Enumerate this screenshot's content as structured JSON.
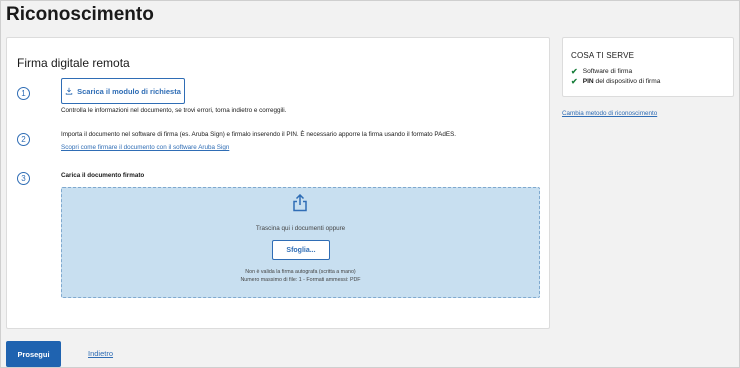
{
  "page": {
    "title": "Riconoscimento"
  },
  "main": {
    "section_title": "Firma digitale remota",
    "steps": [
      {
        "number": "1",
        "button_label": "Scarica il modulo di richiesta",
        "text": "Controlla le informazioni nel documento, se trovi errori, torna indietro e correggili."
      },
      {
        "number": "2",
        "text": "Importa il documento nel software di firma (es. Aruba Sign) e firmalo inserendo il PIN. È necessario apporre la firma usando il formato PAdES.",
        "link": "Scopri come firmare il documento con il software Aruba Sign"
      },
      {
        "number": "3",
        "label": "Carica il documento firmato"
      }
    ],
    "dropzone": {
      "instruction": "Trascina qui i documenti oppure",
      "browse_label": "Sfoglia...",
      "note_1": "Non è valida la firma autografa (scritta a mano)",
      "note_2": "Numero massimo di file: 1 - Formati ammessi: PDF"
    }
  },
  "sidebar": {
    "title": "COSA TI SERVE",
    "items": [
      {
        "bold": "",
        "text": "Software di firma"
      },
      {
        "bold": "PIN",
        "text": " del dispositivo di firma"
      }
    ],
    "link": "Cambia metodo di riconoscimento"
  },
  "footer": {
    "primary_label": "Prosegui",
    "back_label": "Indietro"
  },
  "colors": {
    "accent": "#1f63b0",
    "dropzone": "#c8dff0",
    "check": "#1a7f3c"
  },
  "icons": [
    "download-icon",
    "upload-icon",
    "check-icon"
  ]
}
